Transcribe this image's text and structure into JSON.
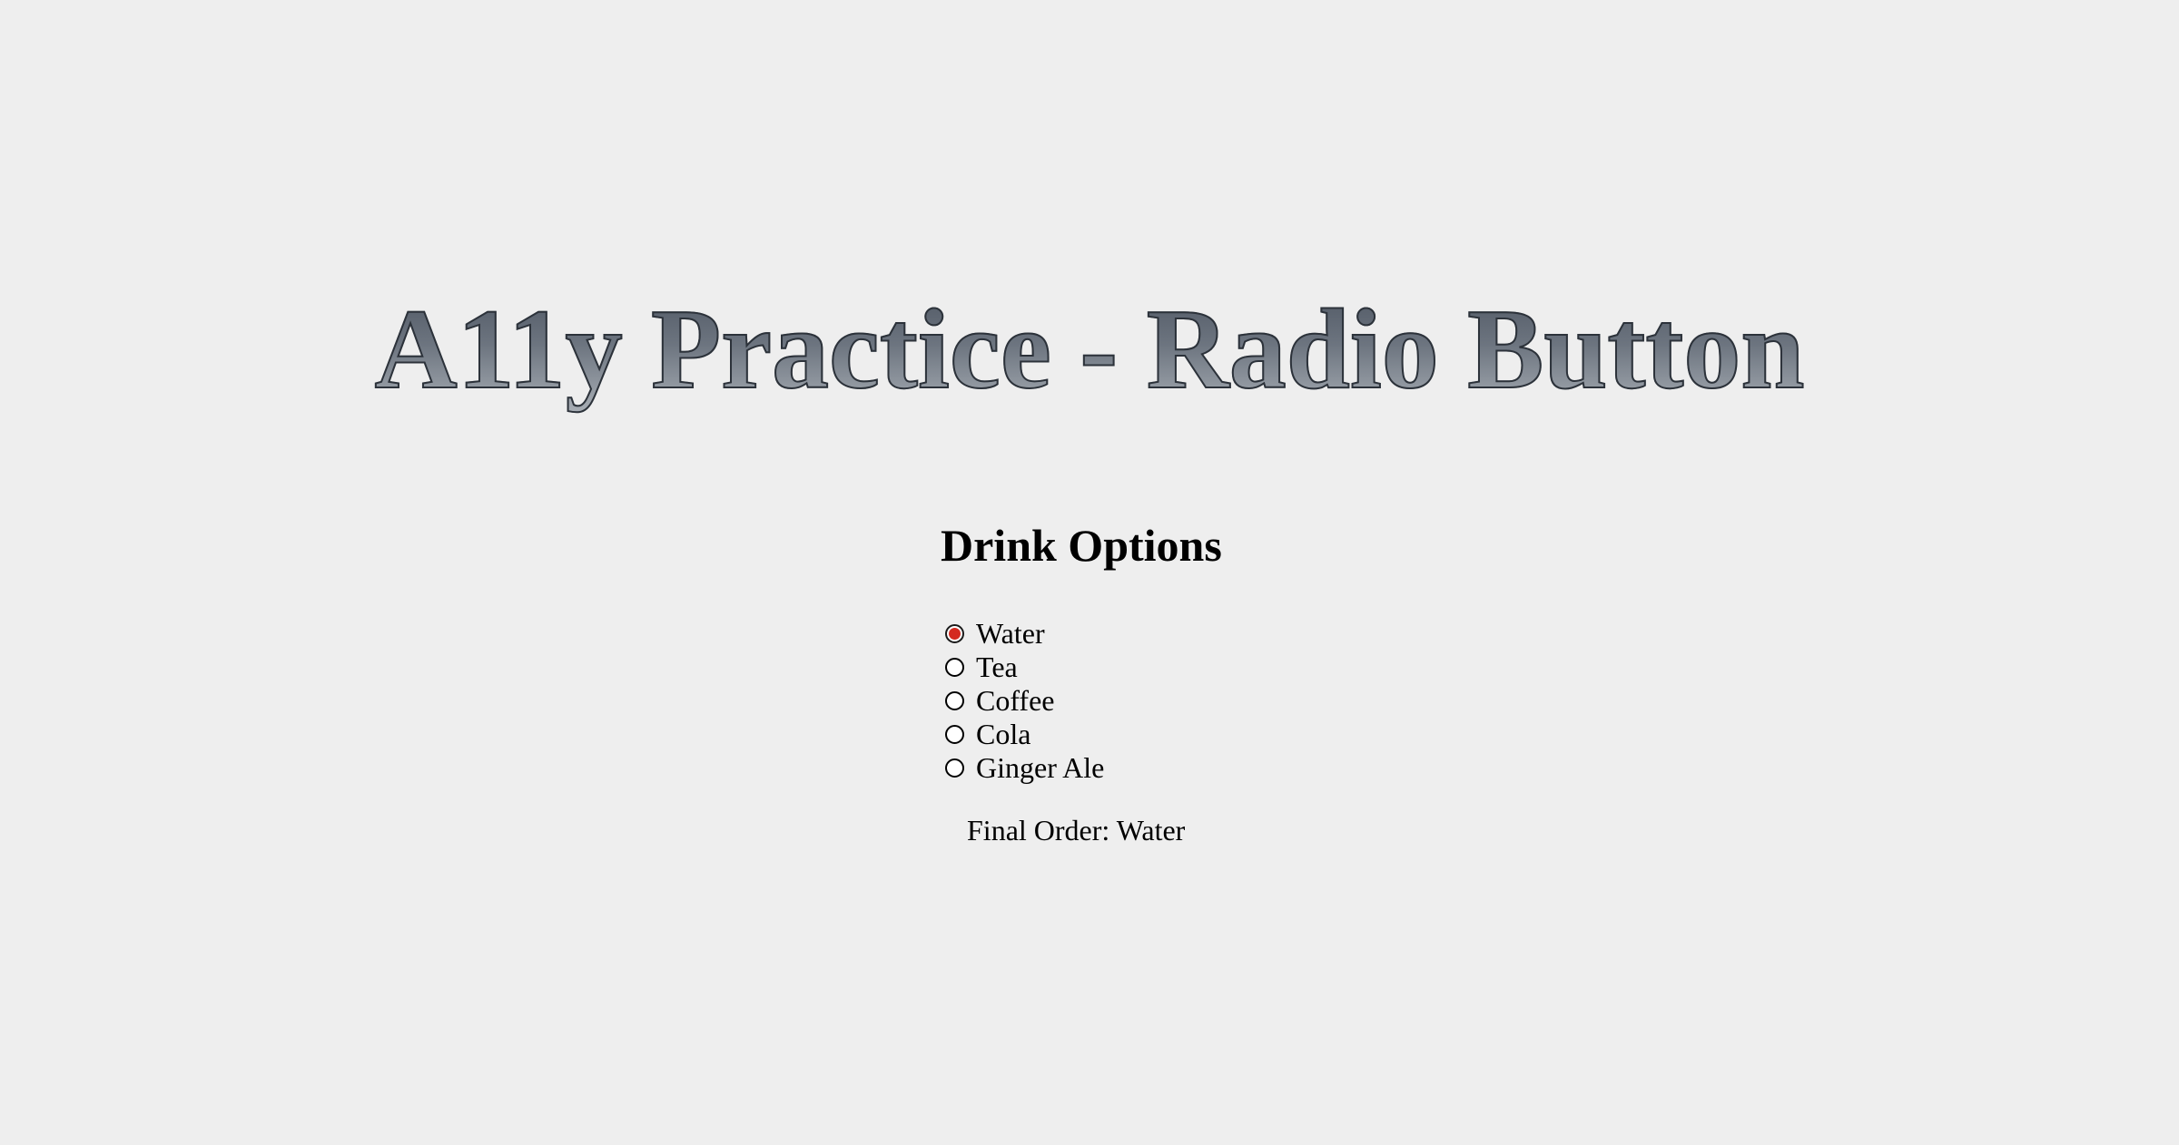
{
  "title": "A11y Practice - Radio Button",
  "drink_options": {
    "legend": "Drink Options",
    "selected": "Water",
    "items": [
      {
        "label": "Water",
        "checked": true
      },
      {
        "label": "Tea",
        "checked": false
      },
      {
        "label": "Coffee",
        "checked": false
      },
      {
        "label": "Cola",
        "checked": false
      },
      {
        "label": "Ginger Ale",
        "checked": false
      }
    ],
    "final_order_label": "Final Order:",
    "final_order_value": "Water"
  },
  "colors": {
    "background": "#eeeeee",
    "selected_radio": "#d42a20",
    "title_gradient_top": "#4f5763",
    "title_gradient_bottom": "#a9afb6"
  }
}
